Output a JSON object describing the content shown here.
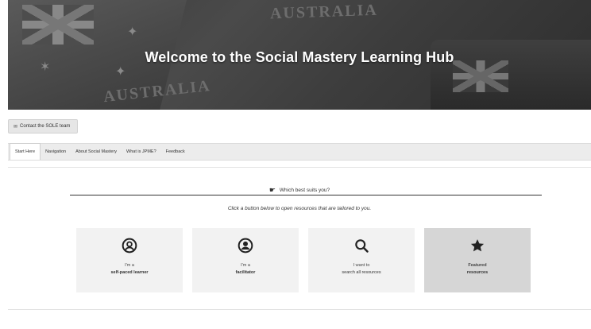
{
  "banner": {
    "title": "Welcome to the Social Mastery Learning Hub",
    "patch_word_top": "AUSTRALIA",
    "patch_word_bottom": "AUSTRALIA"
  },
  "contact_button": {
    "label": "Contact the SOLE team",
    "icon": "mail-icon"
  },
  "tabs": [
    {
      "label": "Start Here",
      "active": true
    },
    {
      "label": "Navigation",
      "active": false
    },
    {
      "label": "About Social Mastery",
      "active": false
    },
    {
      "label": "What is JPME?",
      "active": false
    },
    {
      "label": "Feedback",
      "active": false
    }
  ],
  "content": {
    "prompt": "Which best suits you?",
    "prompt_icon": "pointer-cursor-icon",
    "instruction": "Click a button below to open resources that are tailored to you.",
    "cards": [
      {
        "line1": "I'm a",
        "line2": "self-paced learner",
        "icon": "user-circle-icon"
      },
      {
        "line1": "I'm a",
        "line2": "facilitator",
        "icon": "user-badge-icon"
      },
      {
        "line1": "I want to",
        "line2": "search all resources",
        "icon": "search-icon"
      },
      {
        "line1": "Featured",
        "line2": "resources",
        "icon": "star-icon"
      }
    ]
  },
  "colors": {
    "banner_bg": "#3a3a3a",
    "card_bg": "#f2f2f2",
    "featured_card_bg": "#d6d6d6",
    "tabbar_bg": "#ececec"
  }
}
